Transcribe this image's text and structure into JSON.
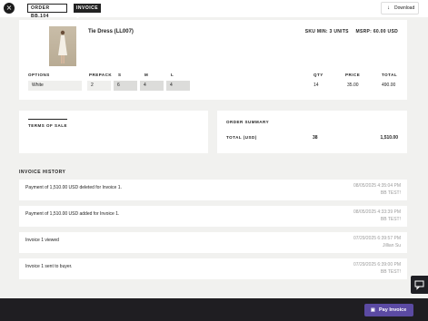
{
  "header": {
    "close_icon": "×",
    "tabs": [
      {
        "label": "ORDER BB.104"
      },
      {
        "label": "INVOICE 1"
      }
    ],
    "download": {
      "icon": "↓",
      "label": "Download"
    }
  },
  "product": {
    "name": "Tie Dress (LL007)",
    "sku_min": "SKU MIN: 3 UNITS",
    "msrp": "MSRP: 60.00 USD",
    "columns": {
      "options": "OPTIONS",
      "prepack": "PREPACK",
      "s": "S",
      "m": "M",
      "l": "L",
      "qty": "QTY",
      "price": "PRICE",
      "total": "TOTAL"
    },
    "row": {
      "option": "White",
      "prepack": "2",
      "s": "6",
      "m": "4",
      "l": "4",
      "qty": "14",
      "price": "35.00",
      "total": "490.00"
    }
  },
  "terms": {
    "label": "TERMS OF SALE"
  },
  "summary": {
    "title": "ORDER SUMMARY",
    "total_label": "TOTAL (USD)",
    "total_qty": "38",
    "total_amount": "1,510.00"
  },
  "history": {
    "title": "INVOICE HISTORY",
    "items": [
      {
        "text": "Payment of 1,510.00 USD deleted for Invoice 1.",
        "time": "08/05/2025 4:35:04 PM",
        "user": "BB TEST!"
      },
      {
        "text": "Payment of 1,510.00 USD added for Invoice 1.",
        "time": "08/05/2025 4:33:39 PM",
        "user": "BB TEST!"
      },
      {
        "text": "Invoice 1 viewed",
        "time": "07/29/2025 6:39:57 PM",
        "user": "Jillian Su"
      },
      {
        "text": "Invoice 1 sent to buyer.",
        "time": "07/29/2025 6:39:00 PM",
        "user": "BB TEST!"
      }
    ]
  },
  "footer": {
    "pay_icon": "▣",
    "pay_label": "Pay Invoice"
  },
  "colors": {
    "accent": "#5b4aa3",
    "dark": "#1f1e22",
    "background": "#f1f1ef"
  }
}
